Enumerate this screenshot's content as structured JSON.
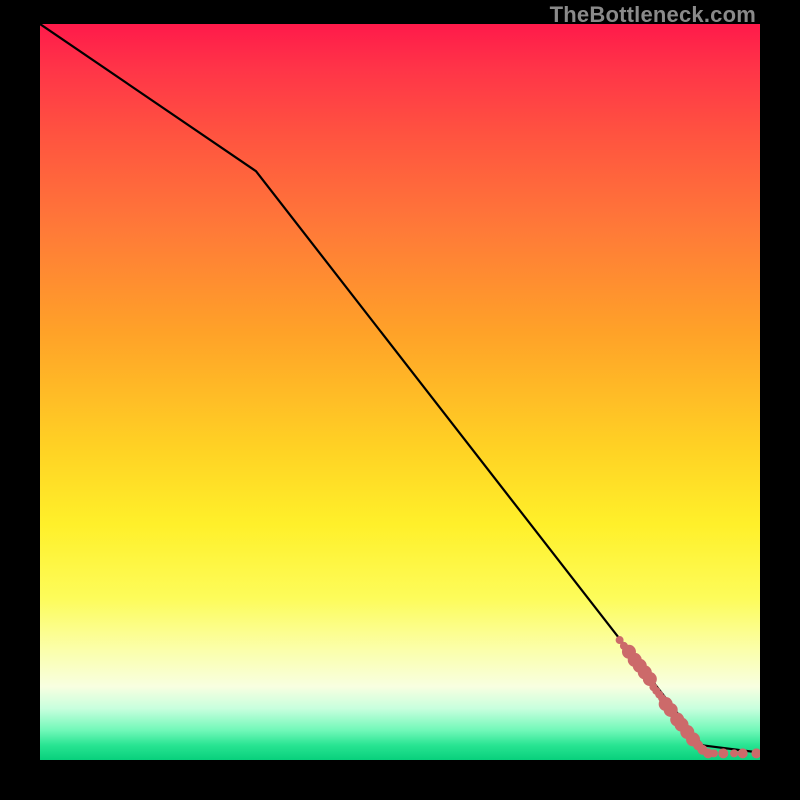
{
  "watermark": "TheBottleneck.com",
  "chart_data": {
    "type": "line",
    "title": "",
    "xlabel": "",
    "ylabel": "",
    "xlim": [
      0,
      100
    ],
    "ylim": [
      0,
      100
    ],
    "grid": false,
    "legend": false,
    "annotations": [],
    "series": [
      {
        "name": "trend-line",
        "type": "line",
        "color": "#000000",
        "x": [
          0,
          30,
          92,
          100
        ],
        "y": [
          100,
          80,
          2,
          1
        ]
      },
      {
        "name": "data-points",
        "type": "scatter",
        "color": "#cc6a6a",
        "points": [
          {
            "x": 80.5,
            "y": 16.3,
            "r": 4
          },
          {
            "x": 81.1,
            "y": 15.5,
            "r": 4
          },
          {
            "x": 81.8,
            "y": 14.7,
            "r": 7
          },
          {
            "x": 82.6,
            "y": 13.6,
            "r": 7
          },
          {
            "x": 83.3,
            "y": 12.8,
            "r": 7
          },
          {
            "x": 84.0,
            "y": 11.9,
            "r": 7
          },
          {
            "x": 84.7,
            "y": 11.0,
            "r": 7
          },
          {
            "x": 85.2,
            "y": 9.9,
            "r": 4
          },
          {
            "x": 85.6,
            "y": 9.4,
            "r": 4
          },
          {
            "x": 86.0,
            "y": 8.9,
            "r": 4
          },
          {
            "x": 86.4,
            "y": 8.4,
            "r": 4
          },
          {
            "x": 86.9,
            "y": 7.6,
            "r": 7
          },
          {
            "x": 87.6,
            "y": 6.8,
            "r": 7
          },
          {
            "x": 88.5,
            "y": 5.5,
            "r": 7
          },
          {
            "x": 89.1,
            "y": 4.8,
            "r": 7
          },
          {
            "x": 89.9,
            "y": 3.8,
            "r": 7
          },
          {
            "x": 90.7,
            "y": 2.8,
            "r": 7
          },
          {
            "x": 91.4,
            "y": 2.0,
            "r": 5
          },
          {
            "x": 92.0,
            "y": 1.4,
            "r": 5
          },
          {
            "x": 92.8,
            "y": 0.9,
            "r": 5
          },
          {
            "x": 93.6,
            "y": 0.9,
            "r": 4
          },
          {
            "x": 94.9,
            "y": 0.9,
            "r": 5
          },
          {
            "x": 96.4,
            "y": 0.9,
            "r": 4
          },
          {
            "x": 97.6,
            "y": 0.9,
            "r": 5
          },
          {
            "x": 99.5,
            "y": 0.9,
            "r": 5
          }
        ]
      }
    ]
  },
  "colors": {
    "line": "#000000",
    "marker": "#cc6a6a",
    "watermark": "#8a8a8a",
    "frame": "#000000"
  }
}
